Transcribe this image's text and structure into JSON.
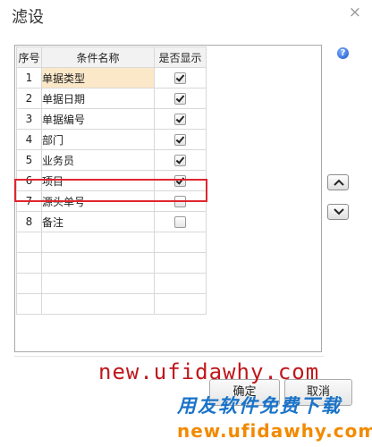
{
  "dialog": {
    "title": "滤设",
    "close": "×"
  },
  "grid": {
    "headers": [
      "序号",
      "条件名称",
      "是否显示"
    ],
    "rows": [
      {
        "seq": "1",
        "name": "单据类型",
        "checked": true
      },
      {
        "seq": "2",
        "name": "单据日期",
        "checked": true
      },
      {
        "seq": "3",
        "name": "单据编号",
        "checked": true
      },
      {
        "seq": "4",
        "name": "部门",
        "checked": true
      },
      {
        "seq": "5",
        "name": "业务员",
        "checked": true
      },
      {
        "seq": "6",
        "name": "项目",
        "checked": true
      },
      {
        "seq": "7",
        "name": "源头单号",
        "checked": false
      },
      {
        "seq": "8",
        "name": "备注",
        "checked": false
      }
    ],
    "selected_row": 0,
    "highlighted_row": 5
  },
  "side": {
    "help_icon": "question-circle-icon",
    "help_glyph": "?",
    "up_icon": "chevron-up-icon",
    "down_icon": "chevron-down-icon"
  },
  "buttons": {
    "ok": "确定",
    "cancel": "取消"
  },
  "watermark": {
    "line1": "new.ufidawhy.com",
    "line2": "用友软件免费下载",
    "line3": "new.ufidawhy.com"
  },
  "colors": {
    "selected_cell": "#fbe8c9",
    "highlight_border": "#e0262e"
  }
}
